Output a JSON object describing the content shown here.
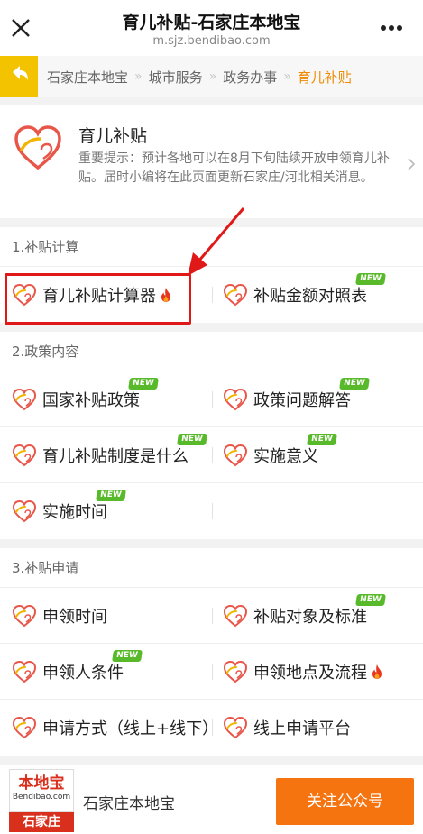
{
  "header": {
    "title": "育儿补贴-石家庄本地宝",
    "url": "m.sjz.bendibao.com"
  },
  "breadcrumb": {
    "items": [
      "石家庄本地宝",
      "城市服务",
      "政务办事"
    ],
    "current": "育儿补贴"
  },
  "intro": {
    "name": "育儿补贴",
    "desc": "重要提示：预计各地可以在8月下旬陆续开放申领育儿补贴。届时小编将在此页面更新石家庄/河北相关消息。"
  },
  "sections": [
    {
      "title": "1.补贴计算",
      "items": [
        {
          "label": "育儿补贴计算器",
          "fire": true,
          "new": false
        },
        {
          "label": "补贴金额对照表",
          "fire": false,
          "new": true
        }
      ]
    },
    {
      "title": "2.政策内容",
      "items": [
        {
          "label": "国家补贴政策",
          "fire": false,
          "new": true
        },
        {
          "label": "政策问题解答",
          "fire": false,
          "new": true
        },
        {
          "label": "育儿补贴制度是什么",
          "fire": false,
          "new": true
        },
        {
          "label": "实施意义",
          "fire": false,
          "new": true
        },
        {
          "label": "实施时间",
          "fire": false,
          "new": true
        }
      ]
    },
    {
      "title": "3.补贴申请",
      "items": [
        {
          "label": "申领时间",
          "fire": false,
          "new": false
        },
        {
          "label": "补贴对象及标准",
          "fire": false,
          "new": true
        },
        {
          "label": "申领人条件",
          "fire": false,
          "new": true
        },
        {
          "label": "申领地点及流程",
          "fire": true,
          "new": false
        },
        {
          "label": "申请方式（线上+线下）",
          "fire": false,
          "new": false
        },
        {
          "label": "线上申请平台",
          "fire": false,
          "new": false
        }
      ]
    }
  ],
  "new_badge": "NEW",
  "footer": {
    "logo_top": "本地宝",
    "logo_sub": "Bendibao.com",
    "logo_city": "石家庄",
    "name": "石家庄本地宝",
    "follow_label": "关注公众号"
  },
  "colors": {
    "accent": "#f08a00",
    "back_button": "#f3c300",
    "follow_button": "#f57410",
    "new_badge": "#58b92a",
    "highlight": "#e01818"
  }
}
